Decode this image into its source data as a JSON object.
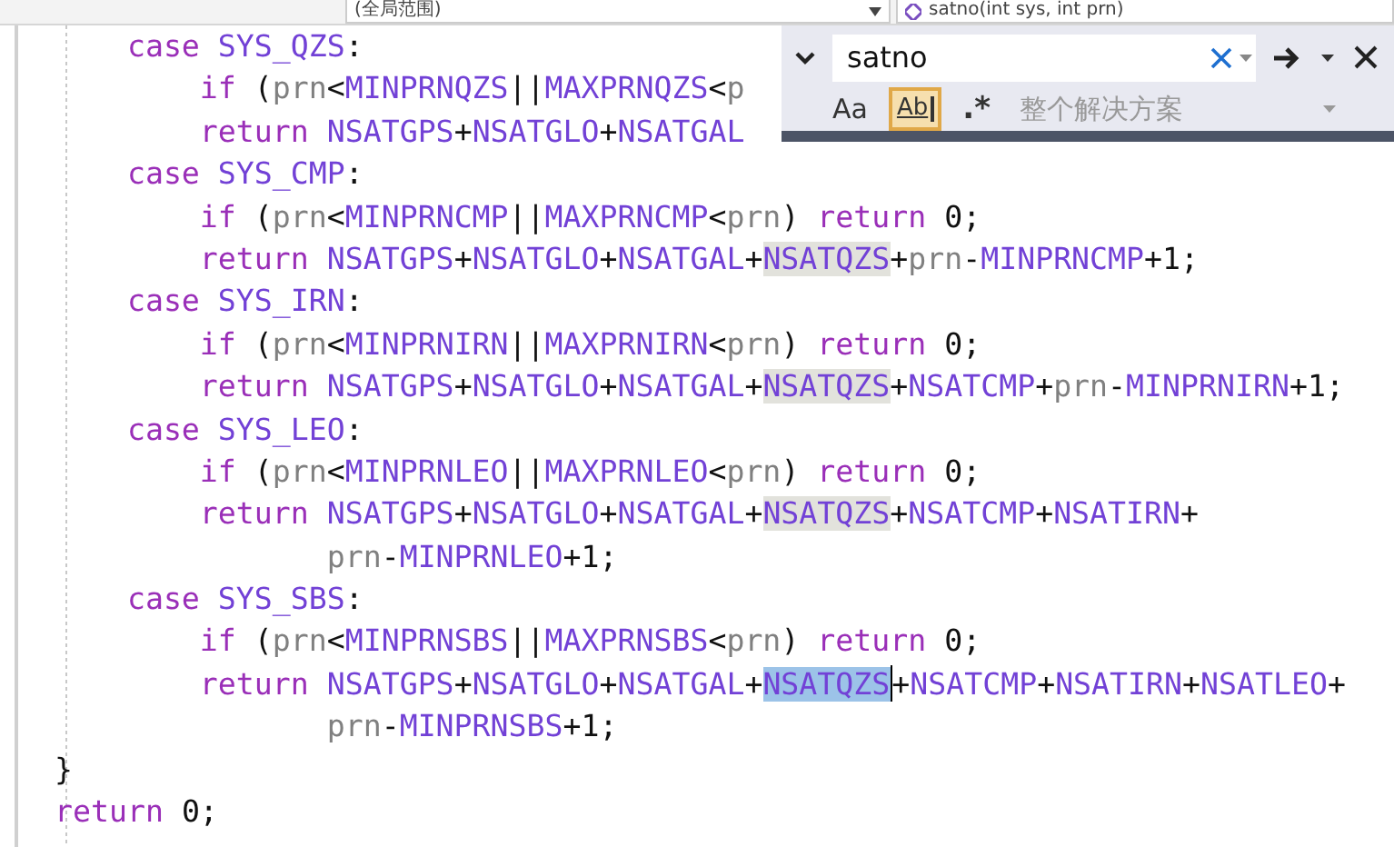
{
  "nav_bar": {
    "scope": "(全局范围)",
    "member": "satno(int sys, int prn)"
  },
  "find_widget": {
    "expanded": true,
    "query": "satno",
    "scope": "整个解决方案",
    "options": [
      {
        "kind": "match-case",
        "label": "Aa",
        "selected": false
      },
      {
        "kind": "whole-word",
        "label": "Ab",
        "selected": true
      },
      {
        "kind": "regex",
        "label": ".*",
        "selected": false
      }
    ]
  },
  "code_lines": [
    {
      "tokens": [
        {
          "text": "    case",
          "kind": "keyword"
        },
        {
          "text": " SYS_QZS",
          "kind": "macro"
        },
        {
          "text": ":",
          "kind": "plain"
        }
      ]
    },
    {
      "tokens": [
        {
          "text": "        if",
          "kind": "keyword"
        },
        {
          "text": " (",
          "kind": "plain"
        },
        {
          "text": "prn",
          "kind": "param"
        },
        {
          "text": "<",
          "kind": "plain"
        },
        {
          "text": "MINPRNQZS",
          "kind": "macro"
        },
        {
          "text": "||",
          "kind": "plain"
        },
        {
          "text": "MAXPRNQZS",
          "kind": "macro"
        },
        {
          "text": "<",
          "kind": "plain"
        },
        {
          "text": "p",
          "kind": "param"
        }
      ]
    },
    {
      "tokens": [
        {
          "text": "        return",
          "kind": "keyword"
        },
        {
          "text": " NSATGPS",
          "kind": "macro"
        },
        {
          "text": "+",
          "kind": "plain"
        },
        {
          "text": "NSATGLO",
          "kind": "macro"
        },
        {
          "text": "+",
          "kind": "plain"
        },
        {
          "text": "NSATGAL",
          "kind": "macro"
        }
      ]
    },
    {
      "tokens": [
        {
          "text": "    case",
          "kind": "keyword"
        },
        {
          "text": " SYS_CMP",
          "kind": "macro"
        },
        {
          "text": ":",
          "kind": "plain"
        }
      ]
    },
    {
      "tokens": [
        {
          "text": "        if",
          "kind": "keyword"
        },
        {
          "text": " (",
          "kind": "plain"
        },
        {
          "text": "prn",
          "kind": "param"
        },
        {
          "text": "<",
          "kind": "plain"
        },
        {
          "text": "MINPRNCMP",
          "kind": "macro"
        },
        {
          "text": "||",
          "kind": "plain"
        },
        {
          "text": "MAXPRNCMP",
          "kind": "macro"
        },
        {
          "text": "<",
          "kind": "plain"
        },
        {
          "text": "prn",
          "kind": "param"
        },
        {
          "text": ") ",
          "kind": "plain"
        },
        {
          "text": "return",
          "kind": "keyword"
        },
        {
          "text": " 0;",
          "kind": "plain"
        }
      ]
    },
    {
      "tokens": [
        {
          "text": "        return",
          "kind": "keyword"
        },
        {
          "text": " NSATGPS",
          "kind": "macro"
        },
        {
          "text": "+",
          "kind": "plain"
        },
        {
          "text": "NSATGLO",
          "kind": "macro"
        },
        {
          "text": "+",
          "kind": "plain"
        },
        {
          "text": "NSATGAL",
          "kind": "macro"
        },
        {
          "text": "+",
          "kind": "plain"
        },
        {
          "text": "NSATQZS",
          "kind": "macro",
          "match": true,
          "selected": false
        },
        {
          "text": "+",
          "kind": "plain"
        },
        {
          "text": "prn",
          "kind": "param"
        },
        {
          "text": "-",
          "kind": "plain"
        },
        {
          "text": "MINPRNCMP",
          "kind": "macro"
        },
        {
          "text": "+1;",
          "kind": "plain"
        }
      ]
    },
    {
      "tokens": [
        {
          "text": "    case",
          "kind": "keyword"
        },
        {
          "text": " SYS_IRN",
          "kind": "macro"
        },
        {
          "text": ":",
          "kind": "plain"
        }
      ]
    },
    {
      "tokens": [
        {
          "text": "        if",
          "kind": "keyword"
        },
        {
          "text": " (",
          "kind": "plain"
        },
        {
          "text": "prn",
          "kind": "param"
        },
        {
          "text": "<",
          "kind": "plain"
        },
        {
          "text": "MINPRNIRN",
          "kind": "macro"
        },
        {
          "text": "||",
          "kind": "plain"
        },
        {
          "text": "MAXPRNIRN",
          "kind": "macro"
        },
        {
          "text": "<",
          "kind": "plain"
        },
        {
          "text": "prn",
          "kind": "param"
        },
        {
          "text": ") ",
          "kind": "plain"
        },
        {
          "text": "return",
          "kind": "keyword"
        },
        {
          "text": " 0;",
          "kind": "plain"
        }
      ]
    },
    {
      "tokens": [
        {
          "text": "        return",
          "kind": "keyword"
        },
        {
          "text": " NSATGPS",
          "kind": "macro"
        },
        {
          "text": "+",
          "kind": "plain"
        },
        {
          "text": "NSATGLO",
          "kind": "macro"
        },
        {
          "text": "+",
          "kind": "plain"
        },
        {
          "text": "NSATGAL",
          "kind": "macro"
        },
        {
          "text": "+",
          "kind": "plain"
        },
        {
          "text": "NSATQZS",
          "kind": "macro",
          "match": true,
          "selected": false
        },
        {
          "text": "+",
          "kind": "plain"
        },
        {
          "text": "NSATCMP",
          "kind": "macro"
        },
        {
          "text": "+",
          "kind": "plain"
        },
        {
          "text": "prn",
          "kind": "param"
        },
        {
          "text": "-",
          "kind": "plain"
        },
        {
          "text": "MINPRNIRN",
          "kind": "macro"
        },
        {
          "text": "+1;",
          "kind": "plain"
        }
      ]
    },
    {
      "tokens": [
        {
          "text": "    case",
          "kind": "keyword"
        },
        {
          "text": " SYS_LEO",
          "kind": "macro"
        },
        {
          "text": ":",
          "kind": "plain"
        }
      ]
    },
    {
      "tokens": [
        {
          "text": "        if",
          "kind": "keyword"
        },
        {
          "text": " (",
          "kind": "plain"
        },
        {
          "text": "prn",
          "kind": "param"
        },
        {
          "text": "<",
          "kind": "plain"
        },
        {
          "text": "MINPRNLEO",
          "kind": "macro"
        },
        {
          "text": "||",
          "kind": "plain"
        },
        {
          "text": "MAXPRNLEO",
          "kind": "macro"
        },
        {
          "text": "<",
          "kind": "plain"
        },
        {
          "text": "prn",
          "kind": "param"
        },
        {
          "text": ") ",
          "kind": "plain"
        },
        {
          "text": "return",
          "kind": "keyword"
        },
        {
          "text": " 0;",
          "kind": "plain"
        }
      ]
    },
    {
      "tokens": [
        {
          "text": "        return",
          "kind": "keyword"
        },
        {
          "text": " NSATGPS",
          "kind": "macro"
        },
        {
          "text": "+",
          "kind": "plain"
        },
        {
          "text": "NSATGLO",
          "kind": "macro"
        },
        {
          "text": "+",
          "kind": "plain"
        },
        {
          "text": "NSATGAL",
          "kind": "macro"
        },
        {
          "text": "+",
          "kind": "plain"
        },
        {
          "text": "NSATQZS",
          "kind": "macro",
          "match": true,
          "selected": false
        },
        {
          "text": "+",
          "kind": "plain"
        },
        {
          "text": "NSATCMP",
          "kind": "macro"
        },
        {
          "text": "+",
          "kind": "plain"
        },
        {
          "text": "NSATIRN",
          "kind": "macro"
        },
        {
          "text": "+",
          "kind": "plain"
        }
      ]
    },
    {
      "tokens": [
        {
          "text": "               prn",
          "kind": "param"
        },
        {
          "text": "-",
          "kind": "plain"
        },
        {
          "text": "MINPRNLEO",
          "kind": "macro"
        },
        {
          "text": "+1;",
          "kind": "plain"
        }
      ]
    },
    {
      "tokens": [
        {
          "text": "    case",
          "kind": "keyword"
        },
        {
          "text": " SYS_SBS",
          "kind": "macro"
        },
        {
          "text": ":",
          "kind": "plain"
        }
      ]
    },
    {
      "tokens": [
        {
          "text": "        if",
          "kind": "keyword"
        },
        {
          "text": " (",
          "kind": "plain"
        },
        {
          "text": "prn",
          "kind": "param"
        },
        {
          "text": "<",
          "kind": "plain"
        },
        {
          "text": "MINPRNSBS",
          "kind": "macro"
        },
        {
          "text": "||",
          "kind": "plain"
        },
        {
          "text": "MAXPRNSBS",
          "kind": "macro"
        },
        {
          "text": "<",
          "kind": "plain"
        },
        {
          "text": "prn",
          "kind": "param"
        },
        {
          "text": ") ",
          "kind": "plain"
        },
        {
          "text": "return",
          "kind": "keyword"
        },
        {
          "text": " 0;",
          "kind": "plain"
        }
      ]
    },
    {
      "tokens": [
        {
          "text": "        return",
          "kind": "keyword"
        },
        {
          "text": " NSATGPS",
          "kind": "macro"
        },
        {
          "text": "+",
          "kind": "plain"
        },
        {
          "text": "NSATGLO",
          "kind": "macro"
        },
        {
          "text": "+",
          "kind": "plain"
        },
        {
          "text": "NSATGAL",
          "kind": "macro"
        },
        {
          "text": "+",
          "kind": "plain"
        },
        {
          "text": "NSATQZS",
          "kind": "macro",
          "match": true,
          "selected": true
        },
        {
          "text": "+",
          "kind": "plain"
        },
        {
          "text": "NSATCMP",
          "kind": "macro"
        },
        {
          "text": "+",
          "kind": "plain"
        },
        {
          "text": "NSATIRN",
          "kind": "macro"
        },
        {
          "text": "+",
          "kind": "plain"
        },
        {
          "text": "NSATLEO",
          "kind": "macro"
        },
        {
          "text": "+",
          "kind": "plain"
        }
      ]
    },
    {
      "tokens": [
        {
          "text": "               prn",
          "kind": "param"
        },
        {
          "text": "-",
          "kind": "plain"
        },
        {
          "text": "MINPRNSBS",
          "kind": "macro"
        },
        {
          "text": "+1;",
          "kind": "plain"
        }
      ]
    },
    {
      "tokens": [
        {
          "text": "}",
          "kind": "plain"
        }
      ]
    },
    {
      "tokens": [
        {
          "text": "return",
          "kind": "keyword"
        },
        {
          "text": " 0;",
          "kind": "plain"
        }
      ]
    }
  ]
}
